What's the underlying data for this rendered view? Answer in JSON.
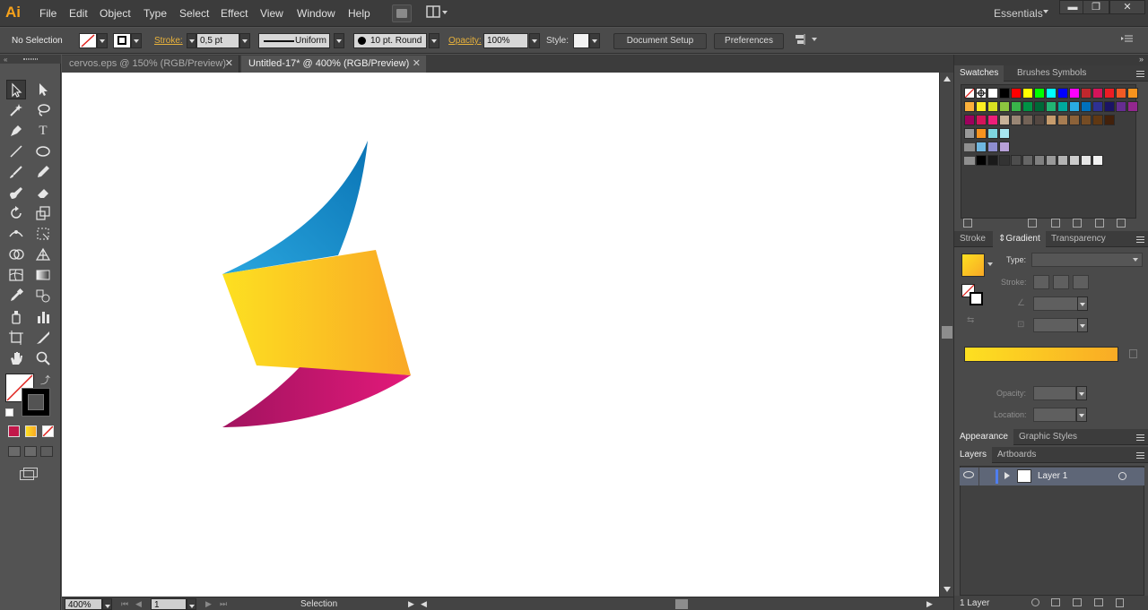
{
  "app": {
    "logo": "Ai"
  },
  "menu": [
    "File",
    "Edit",
    "Object",
    "Type",
    "Select",
    "Effect",
    "View",
    "Window",
    "Help"
  ],
  "workspace": "Essentials",
  "window_controls": {
    "minimize": "▬",
    "restore": "❐",
    "close": "✕"
  },
  "control_bar": {
    "selection": "No Selection",
    "stroke_label": "Stroke:",
    "stroke_weight": "0,5 pt",
    "stroke_profile": "Uniform",
    "brush": "10 pt. Round",
    "opacity_label": "Opacity:",
    "opacity": "100%",
    "style_label": "Style:",
    "document_setup": "Document Setup",
    "preferences": "Preferences"
  },
  "tabs": [
    {
      "label": "cervos.eps @ 150% (RGB/Preview)",
      "close": "✕"
    },
    {
      "label": "Untitled-17* @ 400% (RGB/Preview)",
      "close": "✕"
    }
  ],
  "status": {
    "zoom": "400%",
    "artboard": "1",
    "tool": "Selection"
  },
  "panels": {
    "swatches_tabs": [
      "Swatches",
      "Brushes",
      "Symbols"
    ],
    "gradient_tabs": [
      "Stroke",
      "Gradient",
      "Transparency"
    ],
    "gradient": {
      "type_label": "Type:",
      "stroke_label": "Stroke:",
      "opacity_label": "Opacity:",
      "location_label": "Location:",
      "start_color": "#fde021",
      "end_color": "#f9ab25"
    },
    "appearance_tabs": [
      "Appearance",
      "Graphic Styles"
    ],
    "layers_tabs": [
      "Layers",
      "Artboards"
    ],
    "layer_name": "Layer 1",
    "layer_count": "1 Layer"
  },
  "colors": {
    "accent_orange": "#f7a21b",
    "artwork_blue_light": "#2aa6de",
    "artwork_blue_dark": "#0a74b5",
    "artwork_yellow": "#fde021",
    "artwork_orange": "#f9a825",
    "artwork_magenta_light": "#e3197a",
    "artwork_magenta_dark": "#a1135f"
  }
}
